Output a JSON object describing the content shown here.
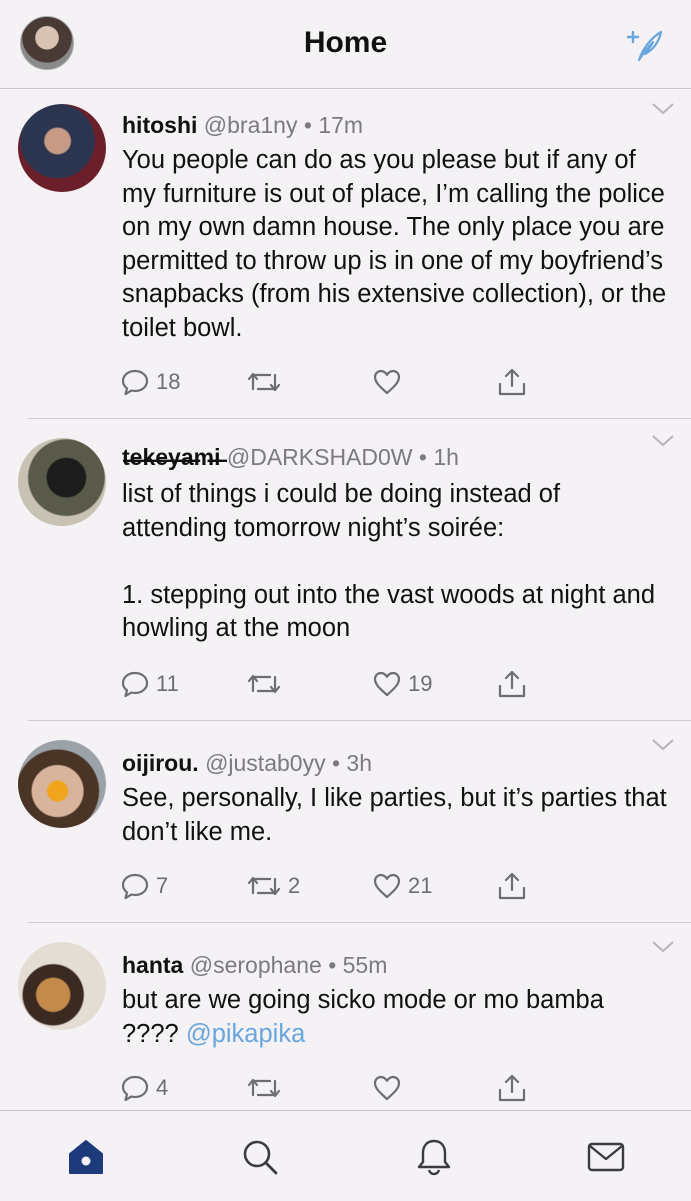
{
  "header": {
    "title": "Home",
    "avatar_icon": "profile-avatar",
    "compose_icon": "compose-feather-icon"
  },
  "colors": {
    "accent": "#1d3b7a",
    "mention": "#6aa6dc",
    "muted": "#7c7a80"
  },
  "tweets": [
    {
      "name": "hitoshi",
      "handle": "@bra1ny",
      "dot": "•",
      "time": "17m",
      "text": "You people can do as you please but if any of my furniture is out of place, I’m calling the police on my own damn house. The only place you are permitted to throw up is in one of my boyfriend’s snapbacks (from his extensive collection), or the toilet bowl.",
      "replies": "18",
      "retweets": "",
      "likes": ""
    },
    {
      "name": "t̶e̶k̶e̶y̶a̶m̶i̶",
      "handle": "@DARKSHAD0W",
      "dot": "•",
      "time": "1h",
      "text": "list of things i could be doing instead of attending tomorrow night’s soirée:\n\n1. stepping out into the vast woods at night and howling at the moon",
      "replies": "11",
      "retweets": "",
      "likes": "19"
    },
    {
      "name": "oijirou.",
      "handle": "@justab0yy",
      "dot": "•",
      "time": "3h",
      "text": "See, personally, I like parties, but it’s parties that don’t like me.",
      "replies": "7",
      "retweets": "2",
      "likes": "21"
    },
    {
      "name": "hanta",
      "handle": "@serophane",
      "dot": "•",
      "time": "55m",
      "text": "but are we going sicko mode or mo bamba ???? ",
      "mention": "@pikapika",
      "replies": "4",
      "retweets": "",
      "likes": ""
    }
  ],
  "tabbar": [
    "home-icon",
    "search-icon",
    "notifications-bell-icon",
    "messages-envelope-icon"
  ]
}
